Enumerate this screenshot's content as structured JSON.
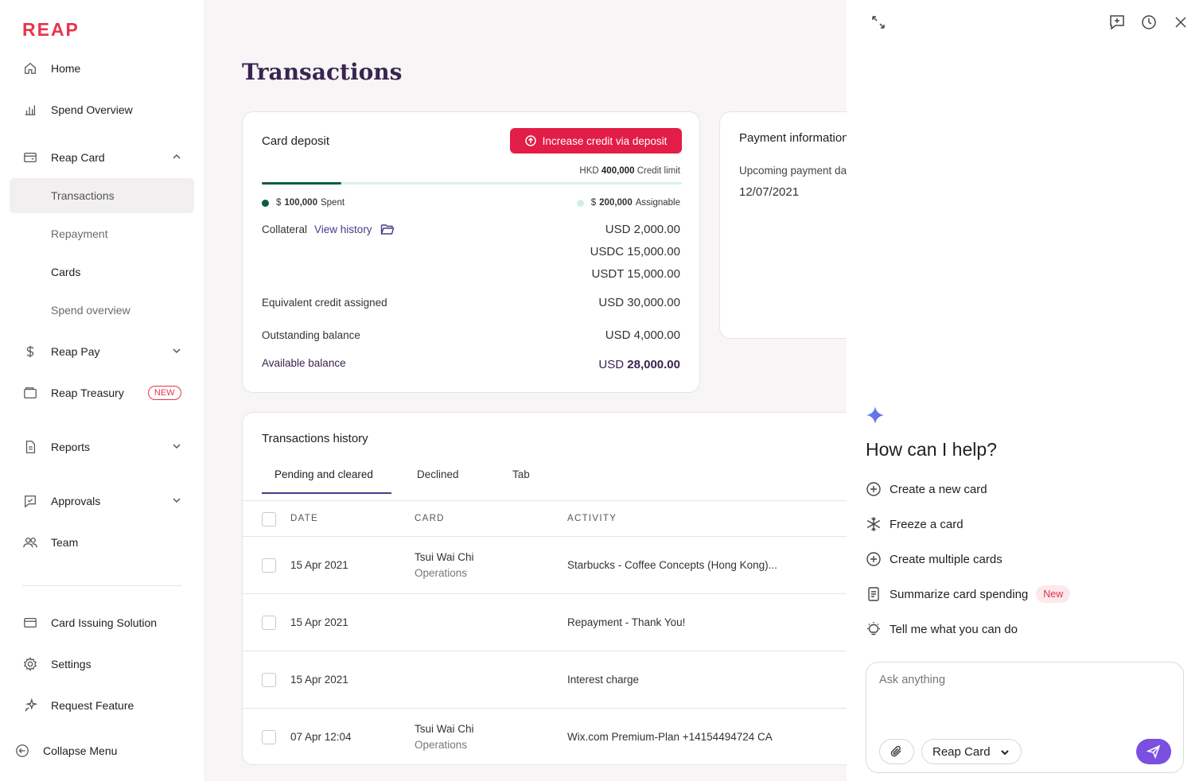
{
  "brand": {
    "logo": "REAP",
    "accent": "#e8344b",
    "primary": "#3a2450",
    "link": "#4b3a86",
    "send": "#7b4fe0"
  },
  "sidebar": {
    "items": [
      {
        "label": "Home",
        "icon": "home-icon"
      },
      {
        "label": "Spend Overview",
        "icon": "bar-chart-icon"
      },
      {
        "label": "Reap Card",
        "icon": "card-icon",
        "expanded": true
      },
      {
        "label": "Reap Pay",
        "icon": "dollar-icon"
      },
      {
        "label": "Reap Treasury",
        "icon": "wallet-icon",
        "badge": "NEW"
      },
      {
        "label": "Reports",
        "icon": "report-icon"
      },
      {
        "label": "Approvals",
        "icon": "approval-icon"
      },
      {
        "label": "Team",
        "icon": "team-icon"
      }
    ],
    "sub_items": [
      "Transactions",
      "Repayment",
      "Cards",
      "Spend overview"
    ],
    "bottom_items": [
      {
        "label": "Card Issuing Solution",
        "icon": "card-issuing-icon"
      },
      {
        "label": "Settings",
        "icon": "gear-icon"
      },
      {
        "label": "Request Feature",
        "icon": "sparkle-icon"
      }
    ],
    "collapse_label": "Collapse Menu"
  },
  "page": {
    "title": "Transactions"
  },
  "deposit": {
    "title": "Card deposit",
    "button": "Increase credit via deposit",
    "credit_limit_currency": "HKD",
    "credit_limit_value": "400,000",
    "credit_limit_label": "Credit limit",
    "progress_fraction": 0.19,
    "spent_prefix": "$",
    "spent_value": "100,000",
    "spent_label": "Spent",
    "assignable_prefix": "$",
    "assignable_value": "200,000",
    "assignable_label": "Assignable",
    "collateral_label": "Collateral",
    "view_history": "View history",
    "collateral_amounts": [
      "USD 2,000.00",
      "USDC 15,000.00",
      "USDT 15,000.00"
    ],
    "equivalent_label": "Equivalent credit assigned",
    "equivalent_value": "USD 30,000.00",
    "outstanding_label": "Outstanding balance",
    "outstanding_value": "USD 4,000.00",
    "available_label": "Available balance",
    "available_currency": "USD",
    "available_value": "28,000.00"
  },
  "payment": {
    "title": "Payment information",
    "upcoming_label": "Upcoming payment date",
    "upcoming_date": "12/07/2021"
  },
  "history": {
    "title": "Transactions history",
    "tabs": [
      "Pending and cleared",
      "Declined",
      "Tab"
    ],
    "columns": [
      "DATE",
      "CARD",
      "ACTIVITY"
    ],
    "rows": [
      {
        "date": "15 Apr 2021",
        "card_name": "Tsui Wai Chi",
        "card_team": "Operations",
        "activity": "Starbucks - Coffee Concepts (Hong Kong)..."
      },
      {
        "date": "15 Apr 2021",
        "card_name": "",
        "card_team": "",
        "activity": "Repayment - Thank You!"
      },
      {
        "date": "15 Apr 2021",
        "card_name": "",
        "card_team": "",
        "activity": "Interest charge"
      },
      {
        "date": "07 Apr 12:04",
        "card_name": "Tsui Wai Chi",
        "card_team": "Operations",
        "activity": "Wix.com Premium-Plan +14154494724 CA"
      }
    ]
  },
  "assistant": {
    "heading": "How can I help?",
    "suggestions": [
      {
        "label": "Create a new card",
        "icon": "plus-circle-icon"
      },
      {
        "label": "Freeze a card",
        "icon": "snowflake-icon"
      },
      {
        "label": "Create multiple cards",
        "icon": "plus-circle-icon"
      },
      {
        "label": "Summarize card spending",
        "icon": "document-icon",
        "badge": "New"
      },
      {
        "label": "Tell me what you can do",
        "icon": "lightbulb-icon"
      }
    ],
    "input_placeholder": "Ask anything",
    "context_select": "Reap Card"
  }
}
